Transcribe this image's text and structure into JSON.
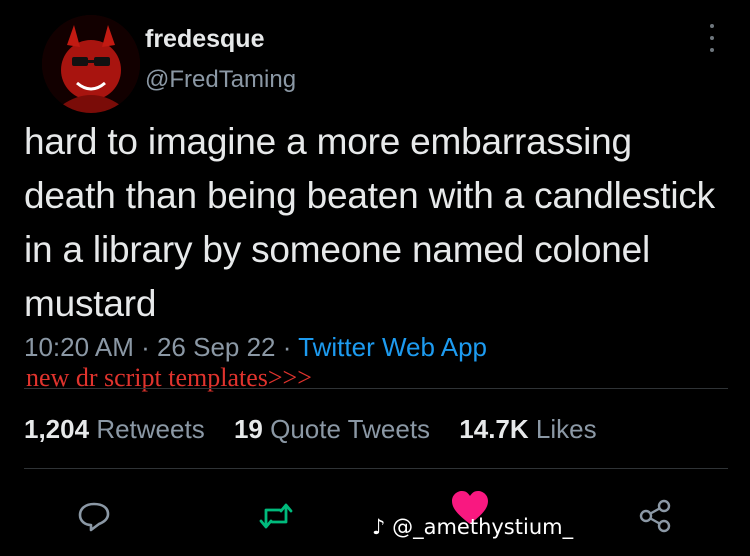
{
  "author": {
    "display_name": "fredesque",
    "handle": "@FredTaming"
  },
  "tweet": {
    "text": "hard to imagine a more embarrassing death than being beaten with a candlestick in a library by someone named colonel mustard",
    "time": "10:20 AM",
    "date": "26 Sep 22",
    "source": "Twitter Web App",
    "separator": " · "
  },
  "overlay": {
    "caption": "new dr script templates>>>"
  },
  "stats": {
    "retweets_count": "1,204",
    "retweets_label": "Retweets",
    "quotes_count": "19",
    "quotes_label": "Quote Tweets",
    "likes_count": "14.7K",
    "likes_label": "Likes"
  },
  "actions": [
    "reply-icon",
    "retweet-icon",
    "like-icon",
    "share-icon"
  ],
  "watermark": {
    "text": "@_amethystium_"
  },
  "colors": {
    "background": "#000000",
    "text": "#e7e9ea",
    "muted": "#8b98a5",
    "link": "#1d9bf0",
    "retweet_active": "#00ba7c",
    "like": "#f91880",
    "caption": "#e0332d"
  }
}
